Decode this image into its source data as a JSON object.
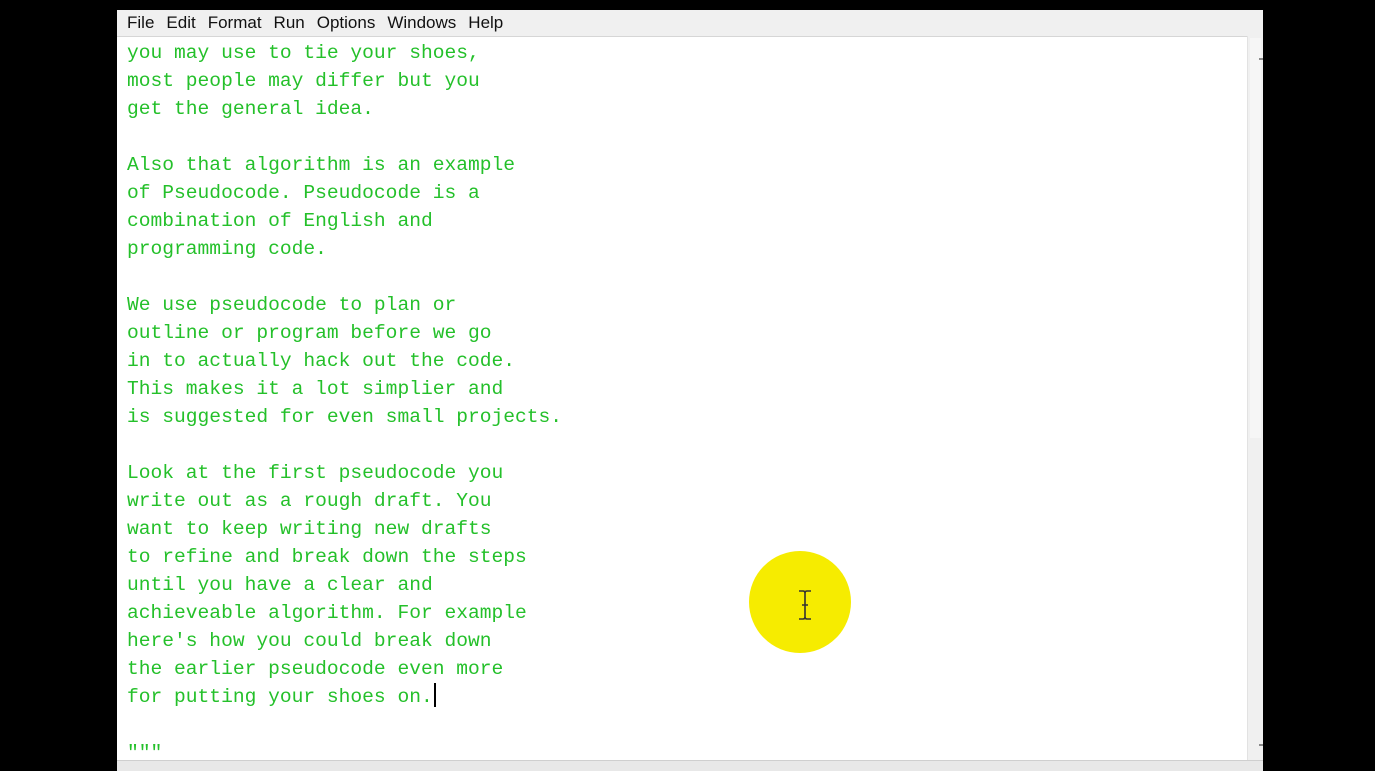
{
  "menubar": {
    "items": [
      "File",
      "Edit",
      "Format",
      "Run",
      "Options",
      "Windows",
      "Help"
    ]
  },
  "editor": {
    "lines": [
      "you may use to tie your shoes,",
      "most people may differ but you",
      "get the general idea.",
      "",
      "Also that algorithm is an example",
      "of Pseudocode. Pseudocode is a",
      "combination of English and",
      "programming code.",
      "",
      "We use pseudocode to plan or",
      "outline or program before we go",
      "in to actually hack out the code.",
      "This makes it a lot simplier and",
      "is suggested for even small projects.",
      "",
      "Look at the first pseudocode you",
      "write out as a rough draft. You",
      "want to keep writing new drafts",
      "to refine and break down the steps",
      "until you have a clear and",
      "achieveable algorithm. For example",
      "here's how you could break down",
      "the earlier pseudocode even more",
      "for putting your shoes on.",
      "",
      "\"\"\""
    ],
    "caret_line": 23,
    "text_color": "#24c02a"
  },
  "cursor_highlight": {
    "color": "#f6ec00",
    "icon": "text-cursor-icon"
  }
}
